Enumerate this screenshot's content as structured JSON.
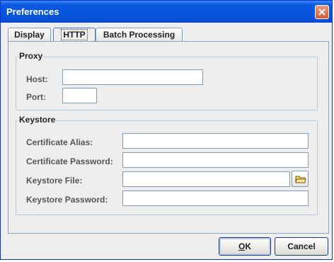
{
  "window": {
    "title": "Preferences"
  },
  "tabs": [
    {
      "label": "Display",
      "active": false
    },
    {
      "label": "HTTP",
      "active": true
    },
    {
      "label": "Batch Processing",
      "active": false
    }
  ],
  "proxy": {
    "title": "Proxy",
    "host_label": "Host:",
    "host_value": "",
    "port_label": "Port:",
    "port_value": ""
  },
  "keystore": {
    "title": "Keystore",
    "cert_alias_label": "Certificate Alias:",
    "cert_alias_value": "",
    "cert_password_label": "Certificate Password:",
    "cert_password_value": "",
    "keystore_file_label": "Keystore File:",
    "keystore_file_value": "",
    "keystore_password_label": "Keystore Password:",
    "keystore_password_value": ""
  },
  "buttons": {
    "ok": "OK",
    "cancel": "Cancel"
  },
  "icons": {
    "close": "close-icon",
    "browse": "folder-icon"
  },
  "colors": {
    "title_bar": "#0a59e0",
    "accent_border": "#7f9db9",
    "panel": "#eeeeee"
  }
}
